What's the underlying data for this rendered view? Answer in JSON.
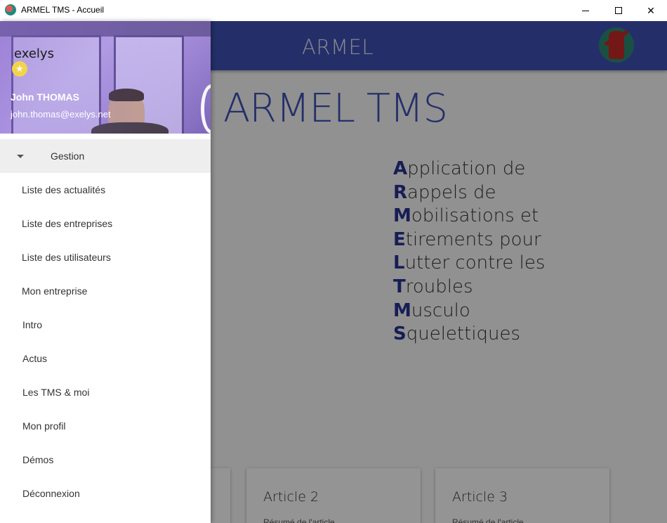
{
  "window": {
    "title": "ARMEL TMS - Accueil",
    "minimize_glyph": "",
    "maximize_glyph": "",
    "close_glyph": "✕"
  },
  "topbar": {
    "app_name": "ARMEL",
    "logo_icon": "armel-figure-logo"
  },
  "hero": {
    "title": "ARMEL TMS",
    "acronym": [
      {
        "cap": "A",
        "rest": "pplication de"
      },
      {
        "cap": "R",
        "rest": "appels de"
      },
      {
        "cap": "M",
        "rest": "obilisations et"
      },
      {
        "cap": "E",
        "rest": "tirements pour"
      },
      {
        "cap": "L",
        "rest": "utter contre les"
      },
      {
        "cap": "T",
        "rest": "roubles"
      },
      {
        "cap": "M",
        "rest": "usculo"
      },
      {
        "cap": "S",
        "rest": "quelettiques"
      }
    ]
  },
  "articles": [
    {
      "title": "",
      "summary": ""
    },
    {
      "title": "Article 2",
      "summary": "Résumé de l'article"
    },
    {
      "title": "Article 3",
      "summary": "Résumé de l'article"
    }
  ],
  "drawer": {
    "brand": "exelys",
    "star_icon": "star-icon",
    "user_name": "John THOMAS",
    "user_email": "john.thomas@exelys.net",
    "group_label": "Gestion",
    "group_items": [
      "Liste des actualités",
      "Liste des entreprises",
      "Liste des utilisateurs",
      "Mon entreprise"
    ],
    "items": [
      "Intro",
      "Actus",
      "Les TMS & moi",
      "Mon profil",
      "Démos",
      "Déconnexion"
    ]
  },
  "colors": {
    "primary": "#3f51b5",
    "accent_dark": "#283593",
    "scrim": "rgba(0,0,0,0.42)"
  }
}
